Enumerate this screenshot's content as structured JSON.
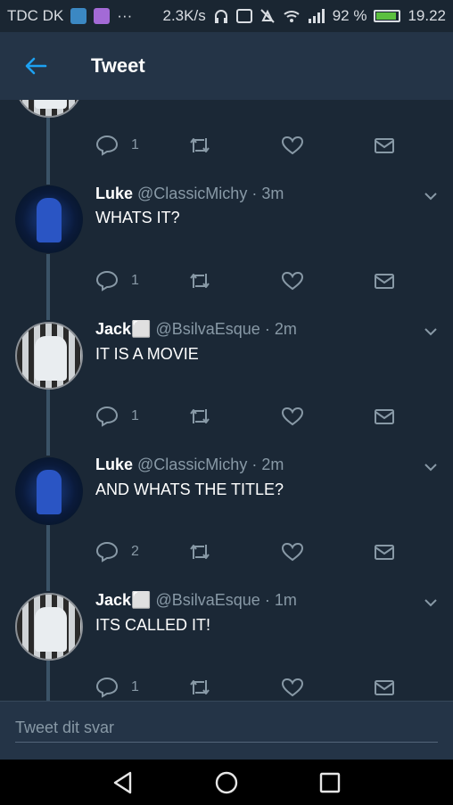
{
  "status_bar": {
    "carrier": "TDC DK",
    "speed": "2.3K/s",
    "battery_percent": "92 %",
    "clock": "19.22"
  },
  "app_bar": {
    "title": "Tweet"
  },
  "tweets": [
    {
      "name": "",
      "handle": "",
      "time": "",
      "text": "",
      "reply_count": "1"
    },
    {
      "name": "Luke",
      "handle": "@ClassicMichy",
      "time": "3m",
      "text": "WHATS IT?",
      "reply_count": "1"
    },
    {
      "name": "Jack⬜",
      "handle": "@BsilvaEsque",
      "time": "2m",
      "text": "IT IS A MOVIE",
      "reply_count": "1"
    },
    {
      "name": "Luke",
      "handle": "@ClassicMichy",
      "time": "2m",
      "text": "AND WHATS THE TITLE?",
      "reply_count": "2"
    },
    {
      "name": "Jack⬜",
      "handle": "@BsilvaEsque",
      "time": "1m",
      "text": "ITS CALLED IT!",
      "reply_count": "1"
    }
  ],
  "separator": "·",
  "reply_box": {
    "placeholder": "Tweet dit svar"
  },
  "colors": {
    "background": "#1b2836",
    "bar": "#243447",
    "accent": "#1da1f2",
    "muted": "#8899a6"
  }
}
